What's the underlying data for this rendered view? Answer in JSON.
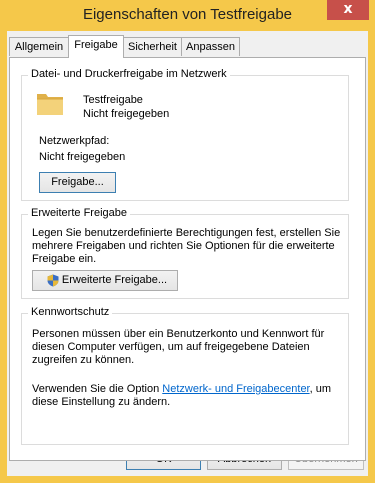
{
  "window": {
    "title": "Eigenschaften von Testfreigabe",
    "close_glyph": "x"
  },
  "tabs": [
    {
      "label": "Allgemein"
    },
    {
      "label": "Freigabe"
    },
    {
      "label": "Sicherheit"
    },
    {
      "label": "Anpassen"
    }
  ],
  "network_sharing": {
    "legend": "Datei- und Druckerfreigabe im Netzwerk",
    "folder_name": "Testfreigabe",
    "folder_status": "Nicht freigegeben",
    "path_label": "Netzwerkpfad:",
    "path_value": "Nicht freigegeben",
    "share_button": "Freigabe..."
  },
  "advanced_sharing": {
    "legend": "Erweiterte Freigabe",
    "description": "Legen Sie benutzerdefinierte Berechtigungen fest, erstellen Sie\nmehrere Freigaben und richten Sie Optionen für die erweiterte\nFreigabe ein.",
    "button": "Erweiterte Freigabe..."
  },
  "password": {
    "legend": "Kennwortschutz",
    "description": "Personen müssen über ein Benutzerkonto und Kennwort für\ndiesen Computer verfügen, um auf freigegebene Dateien\nzugreifen zu können.",
    "use_option_prefix": "Verwenden Sie die Option ",
    "link": "Netzwerk- und Freigabecenter",
    "use_option_suffix": ", um",
    "use_option_line2": "diese Einstellung zu ändern."
  },
  "footer": {
    "ok": "OK",
    "cancel": "Abbrechen",
    "apply": "Übernehmen"
  },
  "colors": {
    "frame": "#f5c84a",
    "close": "#c7504a",
    "link": "#0066cc"
  }
}
